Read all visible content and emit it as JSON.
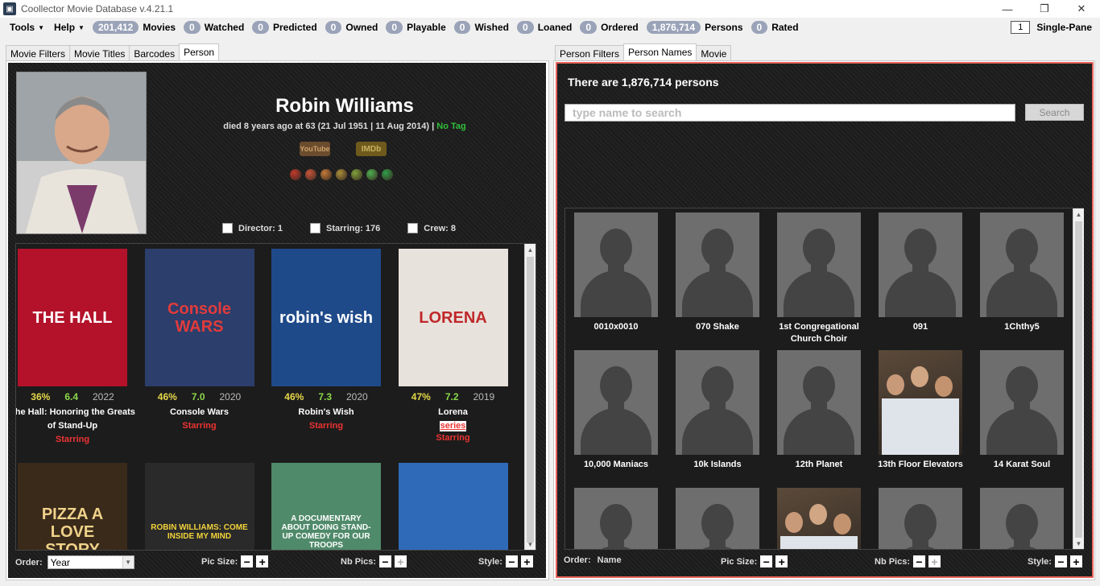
{
  "window": {
    "title": "Coollector Movie Database  v.4.21.1",
    "minimize": "—",
    "restore": "❐",
    "close": "✕"
  },
  "menu": {
    "tools": "Tools",
    "help": "Help"
  },
  "stats": [
    {
      "count": "201,412",
      "label": "Movies"
    },
    {
      "count": "0",
      "label": "Watched"
    },
    {
      "count": "0",
      "label": "Predicted"
    },
    {
      "count": "0",
      "label": "Owned"
    },
    {
      "count": "0",
      "label": "Playable"
    },
    {
      "count": "0",
      "label": "Wished"
    },
    {
      "count": "0",
      "label": "Loaned"
    },
    {
      "count": "0",
      "label": "Ordered"
    },
    {
      "count": "1,876,714",
      "label": "Persons"
    },
    {
      "count": "0",
      "label": "Rated"
    }
  ],
  "single_pane": {
    "value": "1",
    "label": "Single-Pane"
  },
  "left_tabs": [
    "Movie Filters",
    "Movie Titles",
    "Barcodes",
    "Person"
  ],
  "right_tabs": [
    "Person Filters",
    "Person Names",
    "Movie"
  ],
  "person": {
    "name": "Robin Williams",
    "details": "died 8 years ago at 63 (21 Jul 1951 | 11 Aug 2014) |",
    "tag": "No Tag",
    "youtube": "YouTube",
    "imdb": "IMDb",
    "roles": {
      "director": "Director: 1",
      "starring": "Starring: 176",
      "crew": "Crew: 8"
    }
  },
  "rating_faces": [
    "#c0392b",
    "#c8553a",
    "#c27a3a",
    "#a88d3a",
    "#7fa23a",
    "#4caf50",
    "#2e9e4a"
  ],
  "movies": [
    {
      "title": "The Hall: Honoring the Greats of Stand-Up",
      "pct": "36%",
      "rating": "6.4",
      "year": "2022",
      "role": "Starring",
      "series": "",
      "poster_text": "THE HALL",
      "bg": "#b3122a",
      "fg": "#ffffff"
    },
    {
      "title": "Console Wars",
      "pct": "46%",
      "rating": "7.0",
      "year": "2020",
      "role": "Starring",
      "series": "",
      "poster_text": "Console WARS",
      "bg": "#2c3e6b",
      "fg": "#e23b3b"
    },
    {
      "title": "Robin's Wish",
      "pct": "46%",
      "rating": "7.3",
      "year": "2020",
      "role": "Starring",
      "series": "",
      "poster_text": "robin's wish",
      "bg": "#1f4a8a",
      "fg": "#ffffff"
    },
    {
      "title": "Lorena",
      "pct": "47%",
      "rating": "7.2",
      "year": "2019",
      "role": "Starring",
      "series": "series",
      "poster_text": "LORENA",
      "bg": "#e8e2dc",
      "fg": "#c0282a"
    },
    {
      "title": "",
      "pct": "",
      "rating": "",
      "year": "",
      "role": "",
      "series": "",
      "poster_text": "PIZZA A LOVE STORY",
      "bg": "#3a2a1a",
      "fg": "#f0d28a"
    },
    {
      "title": "",
      "pct": "",
      "rating": "",
      "year": "",
      "role": "",
      "series": "",
      "poster_text": "ROBIN WILLIAMS: COME INSIDE MY MIND",
      "bg": "#2a2a2a",
      "fg": "#f2d33a"
    },
    {
      "title": "",
      "pct": "",
      "rating": "",
      "year": "",
      "role": "",
      "series": "",
      "poster_text": "A DOCUMENTARY ABOUT DOING STAND-UP COMEDY FOR OUR TROOPS",
      "bg": "#4f8a6a",
      "fg": "#ffffff"
    },
    {
      "title": "",
      "pct": "",
      "rating": "",
      "year": "",
      "role": "",
      "series": "",
      "poster_text": "",
      "bg": "#2f6ab8",
      "fg": "#ffffff"
    }
  ],
  "left_bottom": {
    "order_label": "Order:",
    "order_value": "Year",
    "pic_size_label": "Pic Size:",
    "nb_pics_label": "Nb Pics:",
    "style_label": "Style:",
    "minus": "−",
    "plus": "+"
  },
  "right_panel": {
    "count_text": "There are 1,876,714 persons",
    "search_placeholder": "type name to search",
    "search_button": "Search"
  },
  "persons": [
    {
      "name": "0010x0010",
      "photo": false
    },
    {
      "name": "070 Shake",
      "photo": false
    },
    {
      "name": "1st Congregational Church Choir",
      "photo": false
    },
    {
      "name": "091",
      "photo": false
    },
    {
      "name": "1Chthy5",
      "photo": false
    },
    {
      "name": "10,000 Maniacs",
      "photo": false
    },
    {
      "name": "10k Islands",
      "photo": false
    },
    {
      "name": "12th Planet",
      "photo": false
    },
    {
      "name": "13th Floor Elevators",
      "photo": true
    },
    {
      "name": "14 Karat Soul",
      "photo": false
    },
    {
      "name": "",
      "photo": false
    },
    {
      "name": "",
      "photo": false
    },
    {
      "name": "",
      "photo": true
    },
    {
      "name": "",
      "photo": false
    },
    {
      "name": "",
      "photo": false
    }
  ],
  "right_bottom": {
    "order_label": "Order:",
    "order_value": "Name",
    "pic_size_label": "Pic Size:",
    "nb_pics_label": "Nb Pics:",
    "style_label": "Style:",
    "minus": "−",
    "plus": "+"
  }
}
